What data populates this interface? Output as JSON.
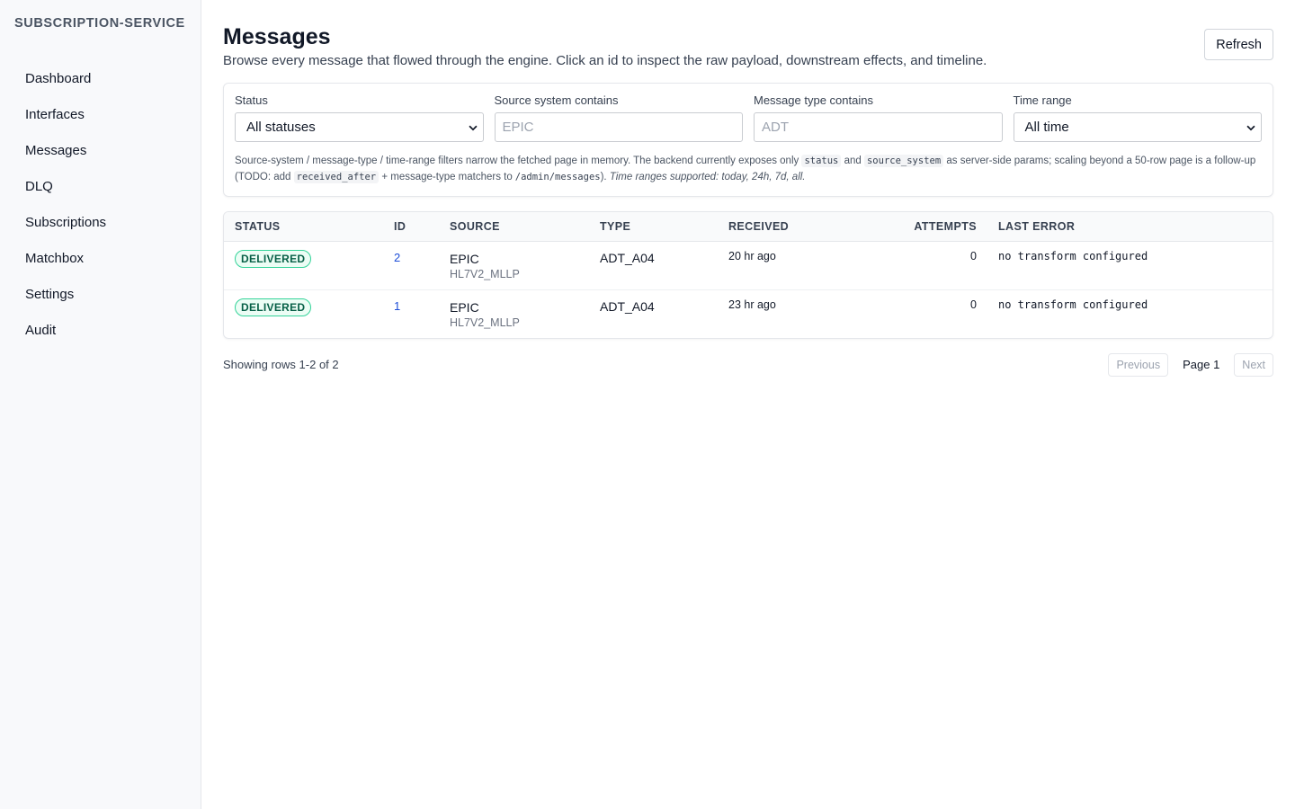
{
  "sidebar": {
    "brand": "SUBSCRIPTION-SERVICE",
    "items": [
      {
        "label": "Dashboard"
      },
      {
        "label": "Interfaces"
      },
      {
        "label": "Messages"
      },
      {
        "label": "DLQ"
      },
      {
        "label": "Subscriptions"
      },
      {
        "label": "Matchbox"
      },
      {
        "label": "Settings"
      },
      {
        "label": "Audit"
      }
    ]
  },
  "header": {
    "title": "Messages",
    "subtitle": "Browse every message that flowed through the engine. Click an id to inspect the raw payload, downstream effects, and timeline.",
    "refresh_label": "Refresh"
  },
  "filters": {
    "status": {
      "label": "Status",
      "value": "All statuses"
    },
    "source_system": {
      "label": "Source system contains",
      "placeholder": "EPIC",
      "value": ""
    },
    "message_type": {
      "label": "Message type contains",
      "placeholder": "ADT",
      "value": ""
    },
    "time_range": {
      "label": "Time range",
      "value": "All time"
    },
    "note": {
      "part1": "Source-system / message-type / time-range filters narrow the fetched page in memory. The backend currently exposes only",
      "code1": "status",
      "part2": "and",
      "code2": "source_system",
      "part3": "as server-side params; scaling beyond a 50-row page is a follow-up (TODO: add",
      "code3": "received_after",
      "part4": "+ message-type matchers to",
      "code4": "/admin/messages",
      "part5": ").",
      "italic": "Time ranges supported: today, 24h, 7d, all."
    }
  },
  "table": {
    "headers": {
      "status": "STATUS",
      "id": "ID",
      "source": "SOURCE",
      "type": "TYPE",
      "received": "RECEIVED",
      "attempts": "ATTEMPTS",
      "last_error": "LAST ERROR"
    },
    "rows": [
      {
        "status": "DELIVERED",
        "id": "2",
        "source": "EPIC",
        "source_sub": "HL7V2_MLLP",
        "type": "ADT_A04",
        "received": "20 hr ago",
        "attempts": "0",
        "last_error": "no transform configured"
      },
      {
        "status": "DELIVERED",
        "id": "1",
        "source": "EPIC",
        "source_sub": "HL7V2_MLLP",
        "type": "ADT_A04",
        "received": "23 hr ago",
        "attempts": "0",
        "last_error": "no transform configured"
      }
    ]
  },
  "pagination": {
    "info": "Showing rows 1-2 of 2",
    "previous": "Previous",
    "page": "Page 1",
    "next": "Next"
  },
  "colors": {
    "badge_delivered_border": "#34d399",
    "badge_delivered_bg": "#ecfdf5",
    "badge_delivered_text": "#065f46",
    "link": "#1d4ed8"
  }
}
